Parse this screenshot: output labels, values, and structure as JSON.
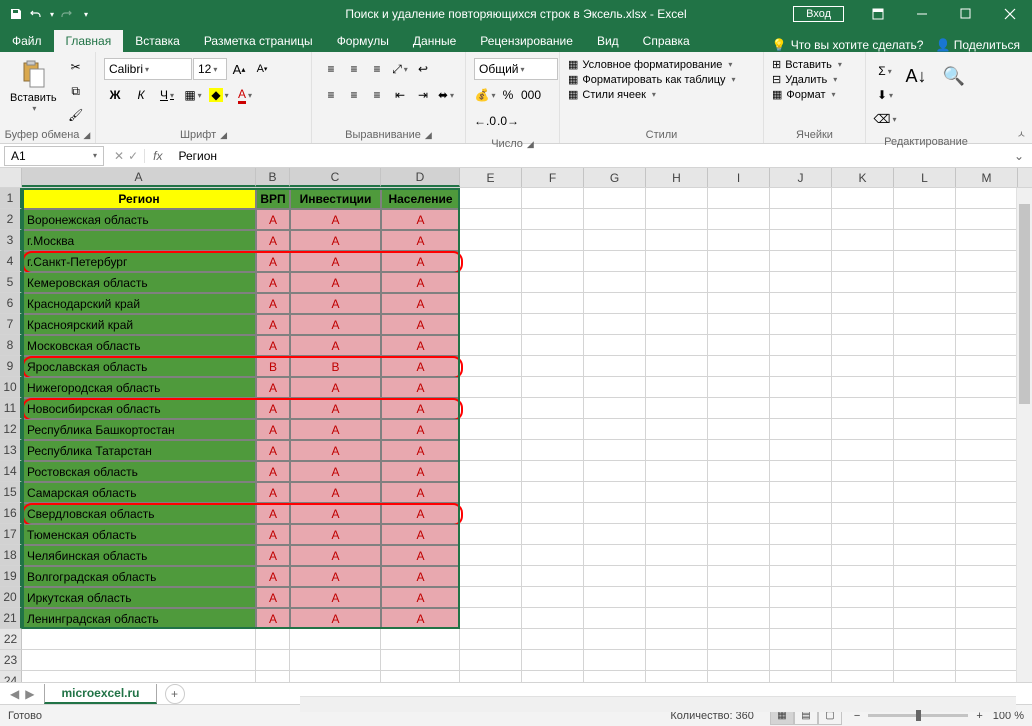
{
  "titlebar": {
    "title": "Поиск и удаление повторяющихся строк в Эксель.xlsx - Excel",
    "signin": "Вход"
  },
  "tabs": {
    "file": "Файл",
    "home": "Главная",
    "insert": "Вставка",
    "layout": "Разметка страницы",
    "formulas": "Формулы",
    "data": "Данные",
    "review": "Рецензирование",
    "view": "Вид",
    "help": "Справка",
    "tellme": "Что вы хотите сделать?",
    "share": "Поделиться"
  },
  "ribbon": {
    "clipboard": {
      "paste": "Вставить",
      "label": "Буфер обмена"
    },
    "font": {
      "name": "Calibri",
      "size": "12",
      "label": "Шрифт"
    },
    "alignment": {
      "label": "Выравнивание"
    },
    "number": {
      "format": "Общий",
      "label": "Число"
    },
    "styles": {
      "cond": "Условное форматирование",
      "table": "Форматировать как таблицу",
      "cell": "Стили ячеек",
      "label": "Стили"
    },
    "cells": {
      "insert": "Вставить",
      "delete": "Удалить",
      "format": "Формат",
      "label": "Ячейки"
    },
    "editing": {
      "label": "Редактирование"
    }
  },
  "formula": {
    "cell": "A1",
    "value": "Регион"
  },
  "columns": [
    "A",
    "B",
    "C",
    "D",
    "E",
    "F",
    "G",
    "H",
    "I",
    "J",
    "K",
    "L",
    "M"
  ],
  "headers": {
    "a": "Регион",
    "b": "ВРП",
    "c": "Инвестиции",
    "d": "Население"
  },
  "rows": [
    {
      "n": 1,
      "a": "Регион",
      "b": "ВРП",
      "c": "Инвестиции",
      "d": "Население",
      "hdr": true
    },
    {
      "n": 2,
      "a": "Воронежская область",
      "b": "A",
      "c": "A",
      "d": "A"
    },
    {
      "n": 3,
      "a": "г.Москва",
      "b": "A",
      "c": "A",
      "d": "A"
    },
    {
      "n": 4,
      "a": "г.Санкт-Петербург",
      "b": "A",
      "c": "A",
      "d": "A",
      "circled": true
    },
    {
      "n": 5,
      "a": "Кемеровская область",
      "b": "A",
      "c": "A",
      "d": "A"
    },
    {
      "n": 6,
      "a": "Краснодарский край",
      "b": "A",
      "c": "A",
      "d": "A"
    },
    {
      "n": 7,
      "a": "Красноярский край",
      "b": "A",
      "c": "A",
      "d": "A"
    },
    {
      "n": 8,
      "a": "Московская область",
      "b": "A",
      "c": "A",
      "d": "A"
    },
    {
      "n": 9,
      "a": "Ярославская область",
      "b": "B",
      "c": "B",
      "d": "A",
      "circled": true
    },
    {
      "n": 10,
      "a": "Нижегородская область",
      "b": "A",
      "c": "A",
      "d": "A"
    },
    {
      "n": 11,
      "a": "Новосибирская область",
      "b": "A",
      "c": "A",
      "d": "A",
      "circled": true
    },
    {
      "n": 12,
      "a": "Республика Башкортостан",
      "b": "A",
      "c": "A",
      "d": "A"
    },
    {
      "n": 13,
      "a": "Республика Татарстан",
      "b": "A",
      "c": "A",
      "d": "A"
    },
    {
      "n": 14,
      "a": "Ростовская область",
      "b": "A",
      "c": "A",
      "d": "A"
    },
    {
      "n": 15,
      "a": "Самарская область",
      "b": "A",
      "c": "A",
      "d": "A"
    },
    {
      "n": 16,
      "a": "Свердловская область",
      "b": "A",
      "c": "A",
      "d": "A",
      "circled": true
    },
    {
      "n": 17,
      "a": "Тюменская область",
      "b": "A",
      "c": "A",
      "d": "A"
    },
    {
      "n": 18,
      "a": "Челябинская область",
      "b": "A",
      "c": "A",
      "d": "A"
    },
    {
      "n": 19,
      "a": "Волгоградская область",
      "b": "A",
      "c": "A",
      "d": "A"
    },
    {
      "n": 20,
      "a": "Иркутская область",
      "b": "A",
      "c": "A",
      "d": "A"
    },
    {
      "n": 21,
      "a": "Ленинградская область",
      "b": "A",
      "c": "A",
      "d": "A"
    }
  ],
  "sheet": {
    "name": "microexcel.ru"
  },
  "status": {
    "ready": "Готово",
    "count": "Количество: 360",
    "zoom": "100 %"
  }
}
